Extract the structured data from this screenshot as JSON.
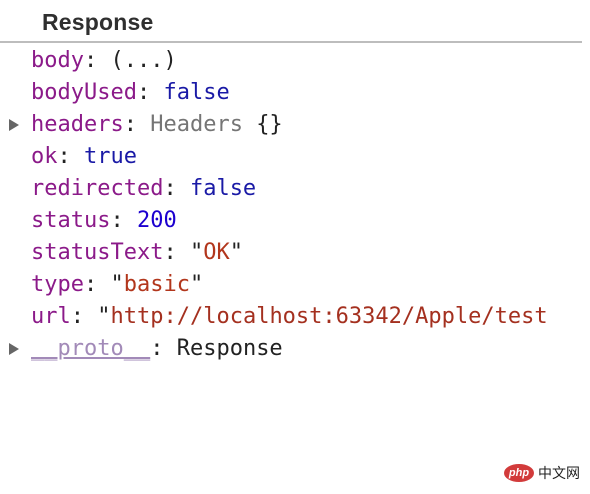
{
  "panel": {
    "title": "Response"
  },
  "properties": [
    {
      "key": "body",
      "value": "(...)",
      "value_kind": "plain",
      "expandable": false
    },
    {
      "key": "bodyUsed",
      "value": "false",
      "value_kind": "keyword",
      "expandable": false
    },
    {
      "key": "headers",
      "value": "Headers",
      "value_suffix": "{}",
      "value_kind": "object",
      "expandable": true
    },
    {
      "key": "ok",
      "value": "true",
      "value_kind": "keyword",
      "expandable": false
    },
    {
      "key": "redirected",
      "value": "false",
      "value_kind": "keyword",
      "expandable": false
    },
    {
      "key": "status",
      "value": "200",
      "value_kind": "number",
      "expandable": false
    },
    {
      "key": "statusText",
      "value": "OK",
      "value_kind": "string",
      "expandable": false
    },
    {
      "key": "type",
      "value": "basic",
      "value_kind": "string",
      "expandable": false
    },
    {
      "key": "url",
      "value": "http://localhost:63342/Apple/test",
      "value_kind": "string-truncated",
      "expandable": false
    },
    {
      "key": "__proto__",
      "value": "Response",
      "value_kind": "plain",
      "expandable": true
    }
  ],
  "watermark": {
    "logo_text": "php",
    "site_text": "中文网",
    "logo_color": "#d23b3b"
  },
  "colors": {
    "key": "#8b1a89",
    "keyword": "#1a1aa6",
    "number": "#1c00cf",
    "string": "#b2361c",
    "object_name": "#757575",
    "header_border": "#bdbdbd"
  }
}
